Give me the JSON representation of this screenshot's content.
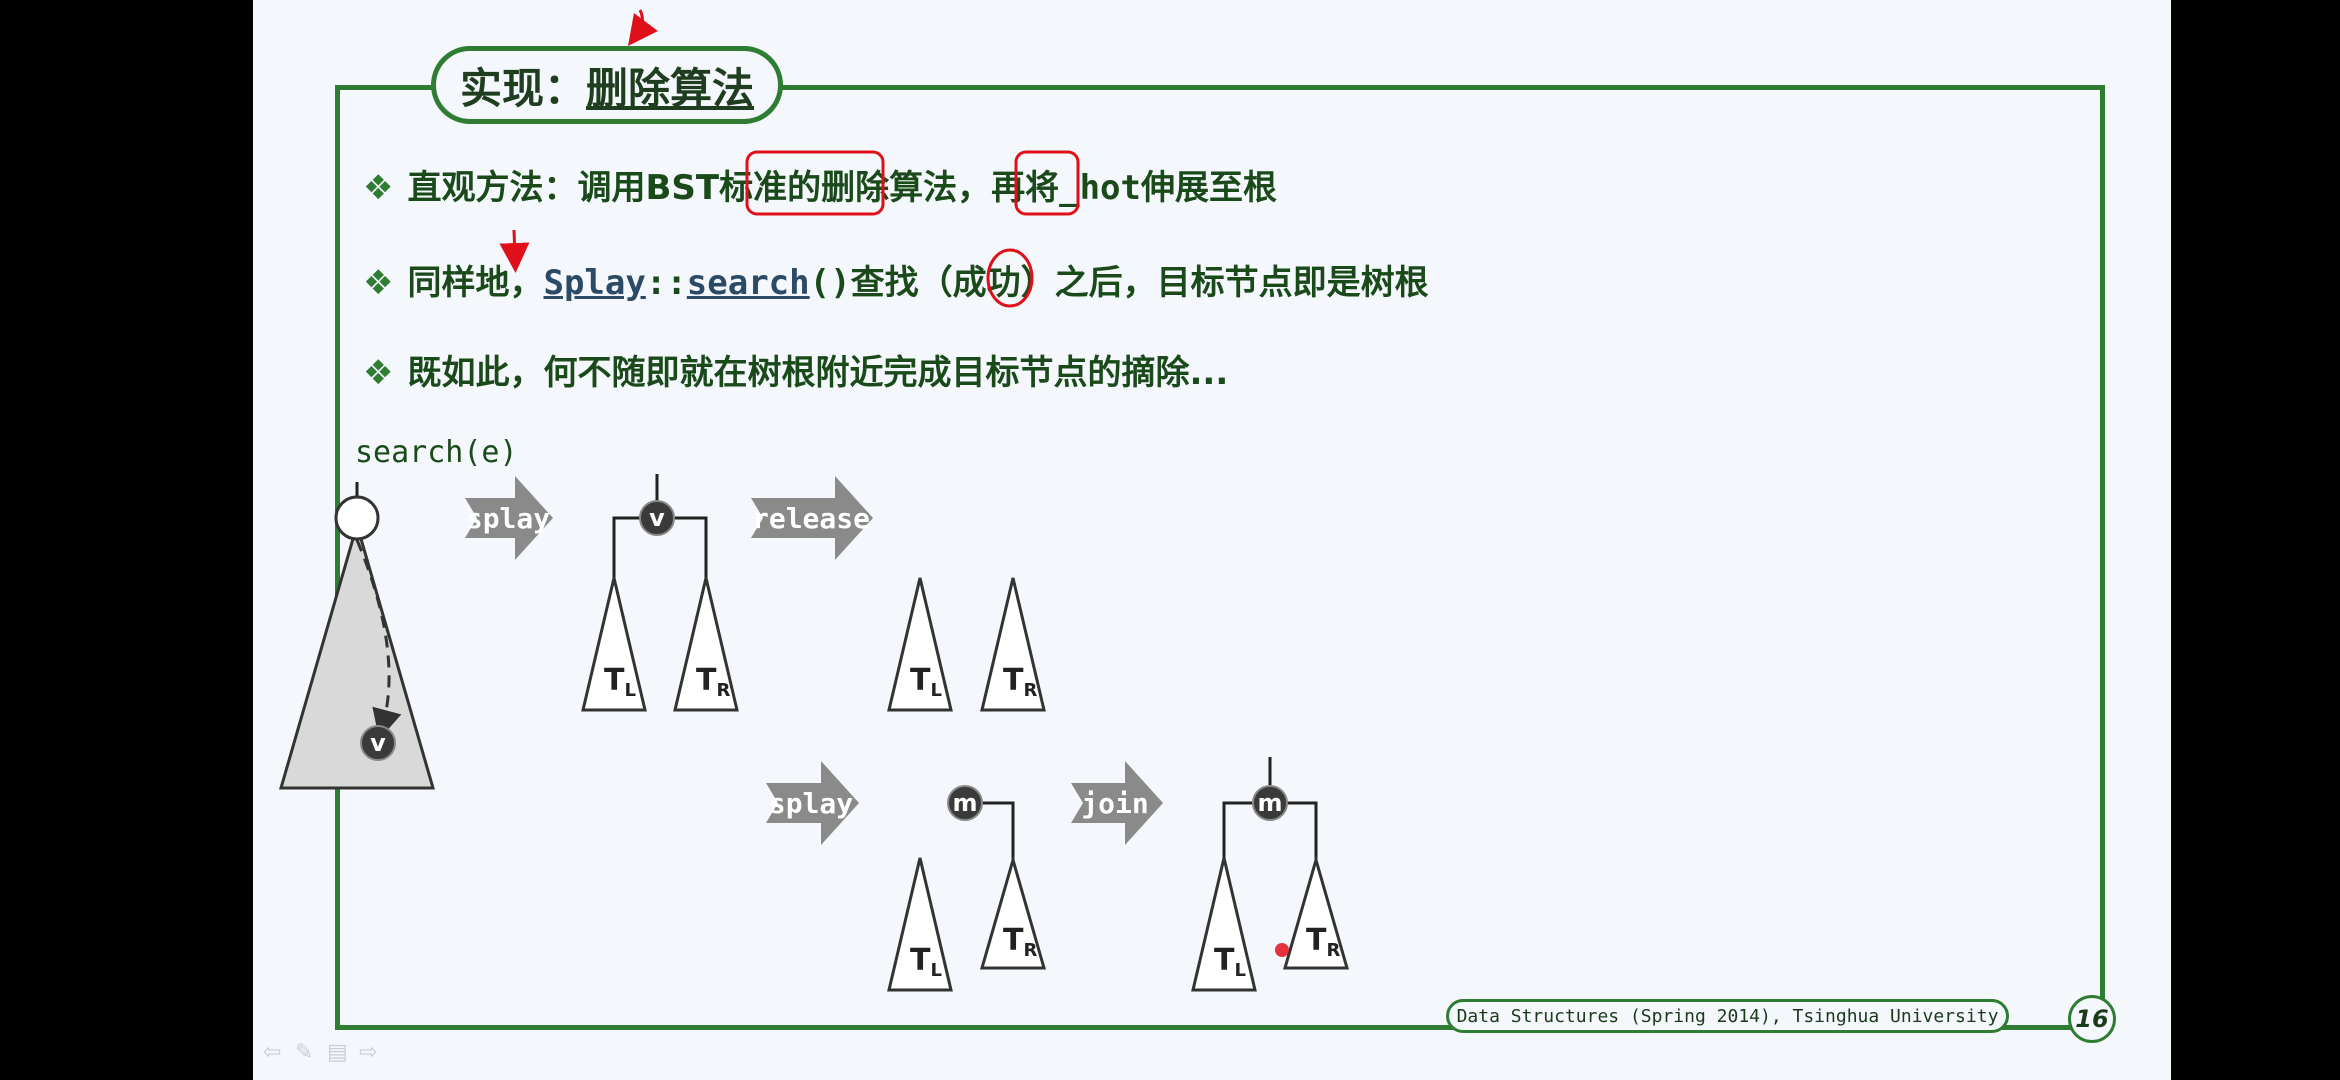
{
  "title": {
    "prefix": "实现：",
    "highlight": "删除算法"
  },
  "bullets": [
    {
      "marker": "❖",
      "text1": "直观方法：调用",
      "bst": "BST",
      "text2": "标准的删除算法，再将",
      "hot": "_hot",
      "text3": "伸展至根"
    },
    {
      "marker": "❖",
      "text1": "同样地，",
      "code1": "Splay",
      "sep": "::",
      "code2": "search",
      "paren": "()",
      "text2": "查找（成功）之后，目标节点即是树根"
    },
    {
      "marker": "❖",
      "text": "既如此，何不随即就在树根附近完成目标节点的摘除..."
    }
  ],
  "diagram": {
    "search_label": "search(e)",
    "node_v": "v",
    "node_m": "m",
    "arrows": {
      "splay1": "splay",
      "release": "release",
      "splay2": "splay",
      "join": "join"
    },
    "subtree_left": {
      "main": "T",
      "sub": "L"
    },
    "subtree_right": {
      "main": "T",
      "sub": "R"
    }
  },
  "footer": "Data Structures (Spring 2014), Tsinghua University",
  "page_number": "16",
  "nav_icons": [
    "back-arrow-icon",
    "pen-icon",
    "menu-icon",
    "forward-arrow-icon"
  ],
  "colors": {
    "frame": "#2e7d32",
    "arrow": "#8a8a8a",
    "annotation": "#e0101a",
    "node_dark": "#3a3a3a"
  }
}
